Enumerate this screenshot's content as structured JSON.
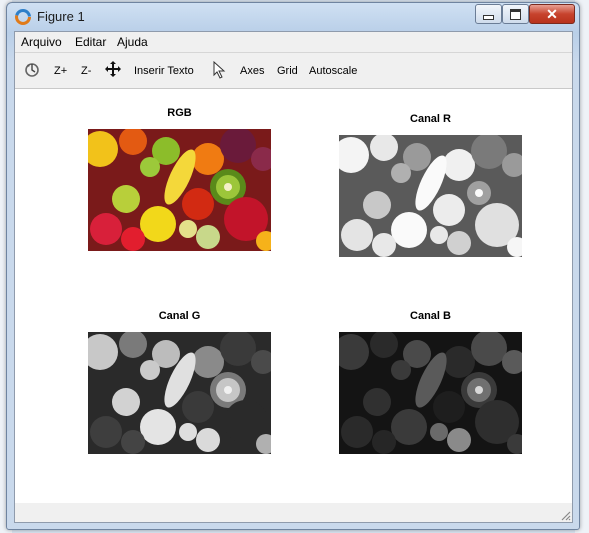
{
  "window": {
    "title": "Figure 1"
  },
  "menu": {
    "items": [
      "Arquivo",
      "Editar",
      "Ajuda"
    ]
  },
  "toolbar": {
    "zoom_in": "Z+",
    "zoom_out": "Z-",
    "insert_text": "Inserir Texto",
    "axes": "Axes",
    "grid": "Grid",
    "autoscale": "Autoscale"
  },
  "subplots": [
    {
      "title": "RGB",
      "mode": "color"
    },
    {
      "title": "Canal R",
      "mode": "red-channel"
    },
    {
      "title": "Canal G",
      "mode": "green-channel"
    },
    {
      "title": "Canal B",
      "mode": "blue-channel"
    }
  ],
  "colors": {
    "titlebar": "#c5d8ee",
    "close_button": "#c7432d",
    "canvas": "#ffffff"
  }
}
